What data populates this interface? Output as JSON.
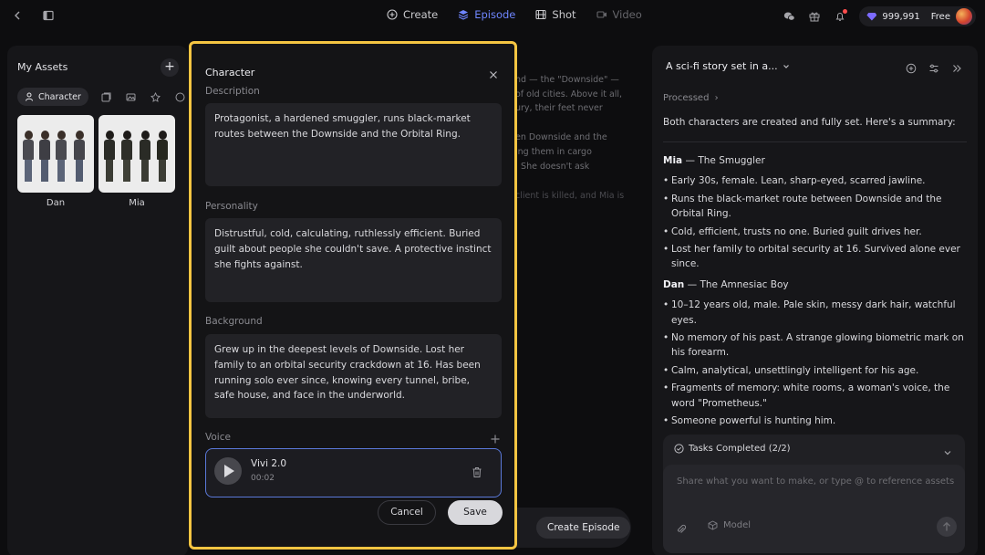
{
  "topbar": {
    "tabs": [
      {
        "label": "Create",
        "icon": "plus-circle-icon",
        "state": "normal"
      },
      {
        "label": "Episode",
        "icon": "layers-icon",
        "state": "active"
      },
      {
        "label": "Shot",
        "icon": "film-icon",
        "state": "normal"
      },
      {
        "label": "Video",
        "icon": "video-icon",
        "state": "disabled"
      }
    ],
    "credits": "999,991",
    "plan": "Free"
  },
  "assets": {
    "title": "My Assets",
    "filter_chip": "Character",
    "items": [
      {
        "name": "Dan"
      },
      {
        "name": "Mia"
      }
    ]
  },
  "background": {
    "lines": [
      "nd — the \"Downside\" —",
      "of old cities. Above it all,",
      "ury, their feet never",
      "en Downside and the",
      "ing them in cargo",
      ". She doesn't ask",
      "client is killed, and Mia is"
    ],
    "create_episode": "Create Episode"
  },
  "modal": {
    "title": "Character",
    "description_label": "Description",
    "description": "Protagonist, a hardened smuggler, runs black-market routes between the Downside and the Orbital Ring.",
    "personality_label": "Personality",
    "personality": "Distrustful, cold, calculating, ruthlessly efficient. Buried guilt about people she couldn't save. A protective instinct she fights against.",
    "background_label": "Background",
    "background": "Grew up in the deepest levels of Downside. Lost her family to an orbital security crackdown at 16. Has been running solo ever since, knowing every tunnel, bribe, safe house, and face in the underworld.",
    "voice_label": "Voice",
    "voice": {
      "name": "Vivi 2.0",
      "duration": "00:02"
    },
    "cancel": "Cancel",
    "save": "Save"
  },
  "chat": {
    "title": "A sci-fi story set in a...",
    "processed": "Processed",
    "summary": "Both characters are created and fully set. Here's a summary:",
    "characters": [
      {
        "name": "Mia",
        "role": "The Smuggler",
        "points": [
          "Early 30s, female. Lean, sharp-eyed, scarred jawline.",
          "Runs the black-market route between Downside and the Orbital Ring.",
          "Cold, efficient, trusts no one. Buried guilt drives her.",
          "Lost her family to orbital security at 16. Survived alone ever since."
        ]
      },
      {
        "name": "Dan",
        "role": "The Amnesiac Boy",
        "points": [
          "10–12 years old, male. Pale skin, messy dark hair, watchful eyes.",
          "No memory of his past. A strange glowing biometric mark on his forearm.",
          "Calm, analytical, unsettlingly intelligent for his age.",
          "Fragments of memory: white rooms, a woman's voice, the word \"Prometheus.\"",
          "Someone powerful is hunting him."
        ]
      }
    ],
    "tasks": "Tasks Completed (2/2)",
    "input_placeholder": "Share what you want to make, or type @ to reference assets",
    "model": "Model"
  }
}
